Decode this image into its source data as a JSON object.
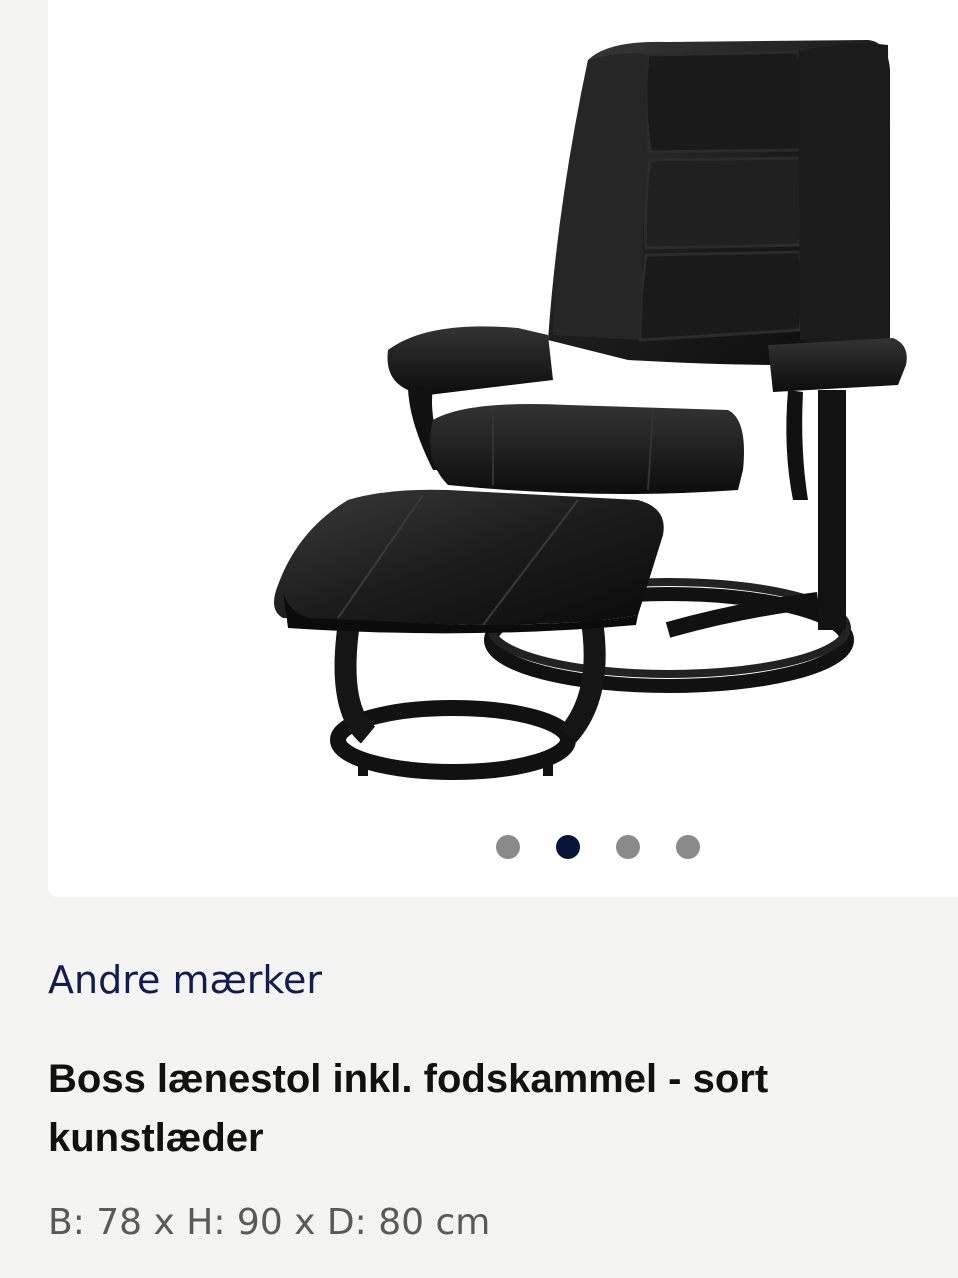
{
  "product": {
    "brand": "Andre mærker",
    "title": "Boss lænestol inkl. fodskammel - sort kunstlæder",
    "dimensions": "B: 78 x H: 90 x D: 80 cm"
  },
  "gallery": {
    "image_subject": "recliner-chair-with-footstool",
    "image_count": 4,
    "active_index": 1
  },
  "colors": {
    "brand_text": "#121c4d",
    "active_dot": "#06143a",
    "inactive_dot": "#8a8a8a",
    "page_background": "#f4f4f2",
    "card_background": "#ffffff"
  }
}
